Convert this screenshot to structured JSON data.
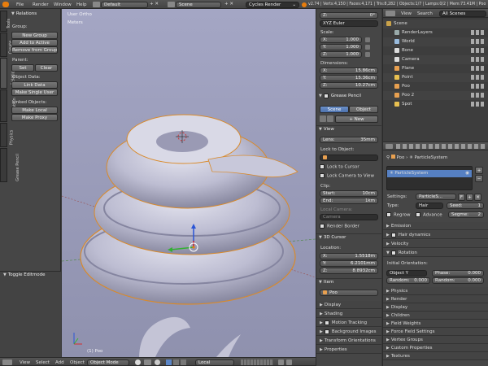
{
  "topbar": {
    "menus": [
      "File",
      "Render",
      "Window",
      "Help"
    ],
    "layout": "Default",
    "scene": "Scene",
    "engine": "Cycles Render",
    "stats": "v2.74 | Verts:4,150 | Faces:4,171 | Tris:8,282 | Objects:1/7 | Lamps:0/2 | Mem:73.41M | Poo"
  },
  "toolshelf": {
    "tabs": [
      "Tools",
      "Create",
      "Relations",
      "Animation",
      "Physics",
      "Grease Pencil"
    ],
    "panel_title": "Relations",
    "group_label": "Group:",
    "group_buttons": [
      "New Group",
      "Add to Active",
      "Remove from Group"
    ],
    "parent_label": "Parent:",
    "parent_buttons": [
      "Set",
      "Clear"
    ],
    "object_data_label": "Object Data:",
    "object_data_buttons": [
      "Link Data",
      "Make Single User"
    ],
    "linked_label": "Linked Objects:",
    "linked_buttons": [
      "Make Local",
      "Make Proxy"
    ],
    "operator": "Toggle Editmode"
  },
  "viewport": {
    "view_name": "User Ortho",
    "units": "Meters",
    "object_label": "(1) Poo",
    "colors": {
      "background_top": "#a3a5c4",
      "background_bottom": "#8e90ae",
      "mesh": "#c9c9dc"
    }
  },
  "bottombar": {
    "menus": [
      "View",
      "Select",
      "Add",
      "Object"
    ],
    "mode": "Object Mode",
    "orientation": "Local"
  },
  "npanel": {
    "rot_z": "0°",
    "rot_mode": "XYZ Euler",
    "scale_label": "Scale:",
    "scale": [
      {
        "k": "X:",
        "v": "1.000"
      },
      {
        "k": "Y:",
        "v": "1.000"
      },
      {
        "k": "Z:",
        "v": "1.000"
      }
    ],
    "dims_label": "Dimensions:",
    "dims": [
      {
        "k": "X:",
        "v": "15.86cm"
      },
      {
        "k": "Y:",
        "v": "15.36cm"
      },
      {
        "k": "Z:",
        "v": "10.27cm"
      }
    ],
    "grease_pencil": "Grease Pencil",
    "gp_tabs": [
      "Scene",
      "Object"
    ],
    "gp_new": "New",
    "view_title": "View",
    "lens": {
      "k": "Lens:",
      "v": "35mm"
    },
    "lock_to_object": "Lock to Object:",
    "lock_to_cursor": "Lock to Cursor",
    "lock_camera": "Lock Camera to View",
    "clip_label": "Clip:",
    "clip_start": {
      "k": "Start:",
      "v": "10cm"
    },
    "clip_end": {
      "k": "End:",
      "v": "1km"
    },
    "local_camera_label": "Local Camera:",
    "camera_field": "Camera",
    "render_border": "Render Border",
    "cursor_title": "3D Cursor",
    "location_label": "Location:",
    "location": [
      {
        "k": "X:",
        "v": "1.5518m"
      },
      {
        "k": "Y:",
        "v": "6.2101mm"
      },
      {
        "k": "Z:",
        "v": "8.8932cm"
      }
    ],
    "item_title": "Item",
    "item_name": "Poo",
    "collapsed": [
      "Display",
      "Shading",
      "Motion Tracking",
      "Background Images",
      "Transform Orientations",
      "Properties"
    ]
  },
  "outliner": {
    "menus": [
      "View",
      "Search"
    ],
    "filter": "All Scenes",
    "items": [
      {
        "name": "Scene",
        "indent": 0
      },
      {
        "name": "RenderLayers",
        "indent": 1
      },
      {
        "name": "World",
        "indent": 1
      },
      {
        "name": "Bone",
        "indent": 1
      },
      {
        "name": "Camera",
        "indent": 1
      },
      {
        "name": "Plane",
        "indent": 1
      },
      {
        "name": "Point",
        "indent": 1
      },
      {
        "name": "Poo",
        "indent": 1
      },
      {
        "name": "Poo 2",
        "indent": 1
      },
      {
        "name": "Spot",
        "indent": 1
      }
    ]
  },
  "properties": {
    "breadcrumb": [
      "Poo",
      "ParticleSystem"
    ],
    "system_name": "ParticleSystem",
    "settings_label": "Settings:",
    "settings_value": "ParticleS...",
    "settings_f": "F",
    "type_label": "Type:",
    "type_value": "Hair",
    "seed_label": "Seed:",
    "seed_value": "1",
    "regrow": "Regrow",
    "advance": "Advance",
    "segments_label": "Segme:",
    "segments_value": "2",
    "panels_top": [
      "Emission",
      "Hair dynamics",
      "Velocity"
    ],
    "rotation_title": "Rotation",
    "initial_orientation": "Initial Orientation:",
    "orient_value": "Object Y",
    "phase_label": "Phase:",
    "phase_value": "0.000",
    "random_label": "Random:",
    "random1": "0.000",
    "random2": "0.000",
    "panels_bottom": [
      "Physics",
      "Render",
      "Display",
      "Children",
      "Field Weights",
      "Force Field Settings",
      "Vertex Groups",
      "Custom Properties",
      "Textures"
    ]
  }
}
